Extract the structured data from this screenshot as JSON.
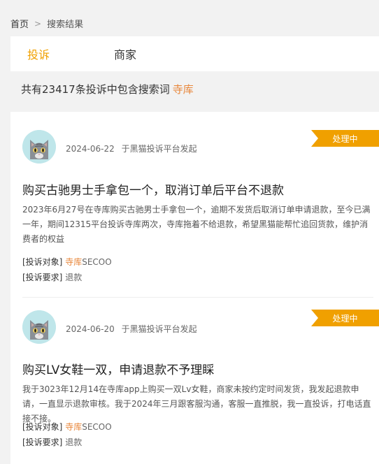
{
  "breadcrumb": {
    "home": "首页",
    "sep": ">",
    "current": "搜索结果"
  },
  "tabs": [
    {
      "label": "投诉",
      "active": true
    },
    {
      "label": "商家",
      "active": false
    }
  ],
  "summary": {
    "prefix": "共有23417条投诉中包含搜索词",
    "keyword": "寺库"
  },
  "accent_color": "#f0a000",
  "complaints": [
    {
      "date": "2024-06-22",
      "source": "于黑猫投诉平台发起",
      "status": "处理中",
      "title": "购买古驰男士手拿包一个，取消订单后平台不退款",
      "body": "2023年6月27号在寺库购买古驰男士手拿包一个，逾期不发货后取消订单申请退款，至今已满一年，期间12315平台投诉寺库两次，寺库拖着不给退款，希望黑猫能帮忙追回货款，维护消费者的权益",
      "target_label": "[投诉对象]",
      "target_highlight": "寺库",
      "target_rest": "SECOO",
      "request_label": "[投诉要求]",
      "request_value": "退款"
    },
    {
      "date": "2024-06-20",
      "source": "于黑猫投诉平台发起",
      "status": "处理中",
      "title": "购买LV女鞋一双，申请退款不予理睬",
      "body": "我于3023年12月14在寺库app上购买一双Lv女鞋，商家未按约定时间发货，我发起退款申请，一直显示退款审核。我于2024年三月跟客服沟通，客服一直推脱，我一直投诉，打电话直接不接。",
      "target_label": "[投诉对象]",
      "target_highlight": "寺库",
      "target_rest": "SECOO",
      "request_label": "[投诉要求]",
      "request_value": "退款"
    }
  ],
  "icons": {
    "avatar": "cat-avatar-icon"
  }
}
